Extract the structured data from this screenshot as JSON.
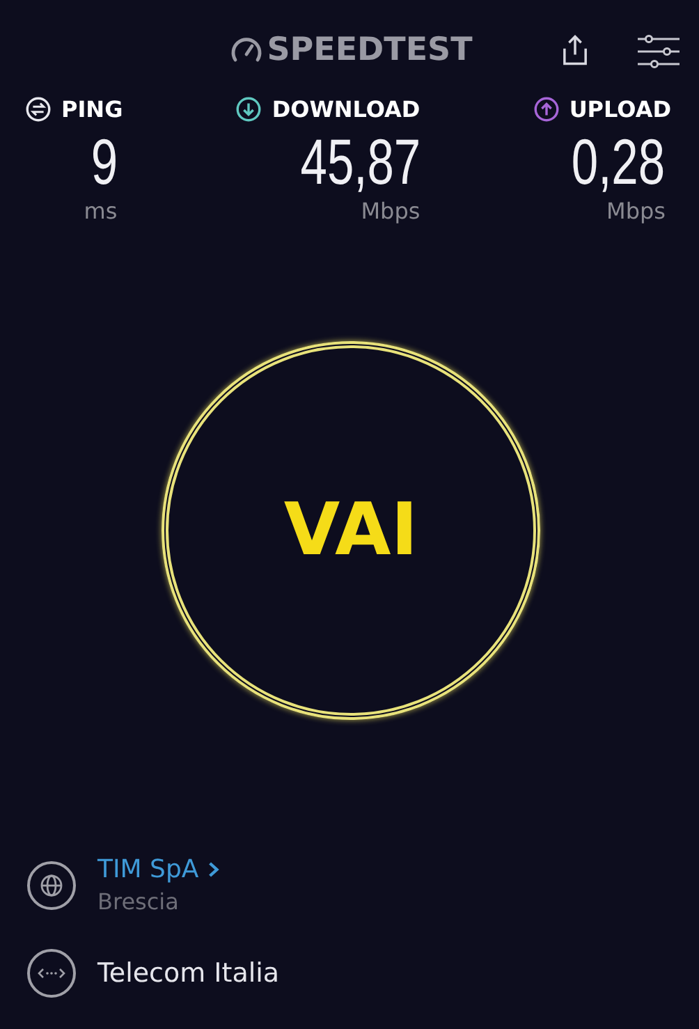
{
  "header": {
    "logo": "SPEEDTEST"
  },
  "metrics": [
    {
      "kind": "ping",
      "label": "PING",
      "value": "9",
      "unit": "ms",
      "color": "#e8e8ee"
    },
    {
      "kind": "download",
      "label": "DOWNLOAD",
      "value": "45,87",
      "unit": "Mbps",
      "color": "#5fc8c0"
    },
    {
      "kind": "upload",
      "label": "UPLOAD",
      "value": "0,28",
      "unit": "Mbps",
      "color": "#a765d8"
    }
  ],
  "go_button": {
    "label": "VAI"
  },
  "provider": {
    "name": "TIM SpA",
    "location": "Brescia"
  },
  "server": {
    "name": "Telecom Italia"
  }
}
